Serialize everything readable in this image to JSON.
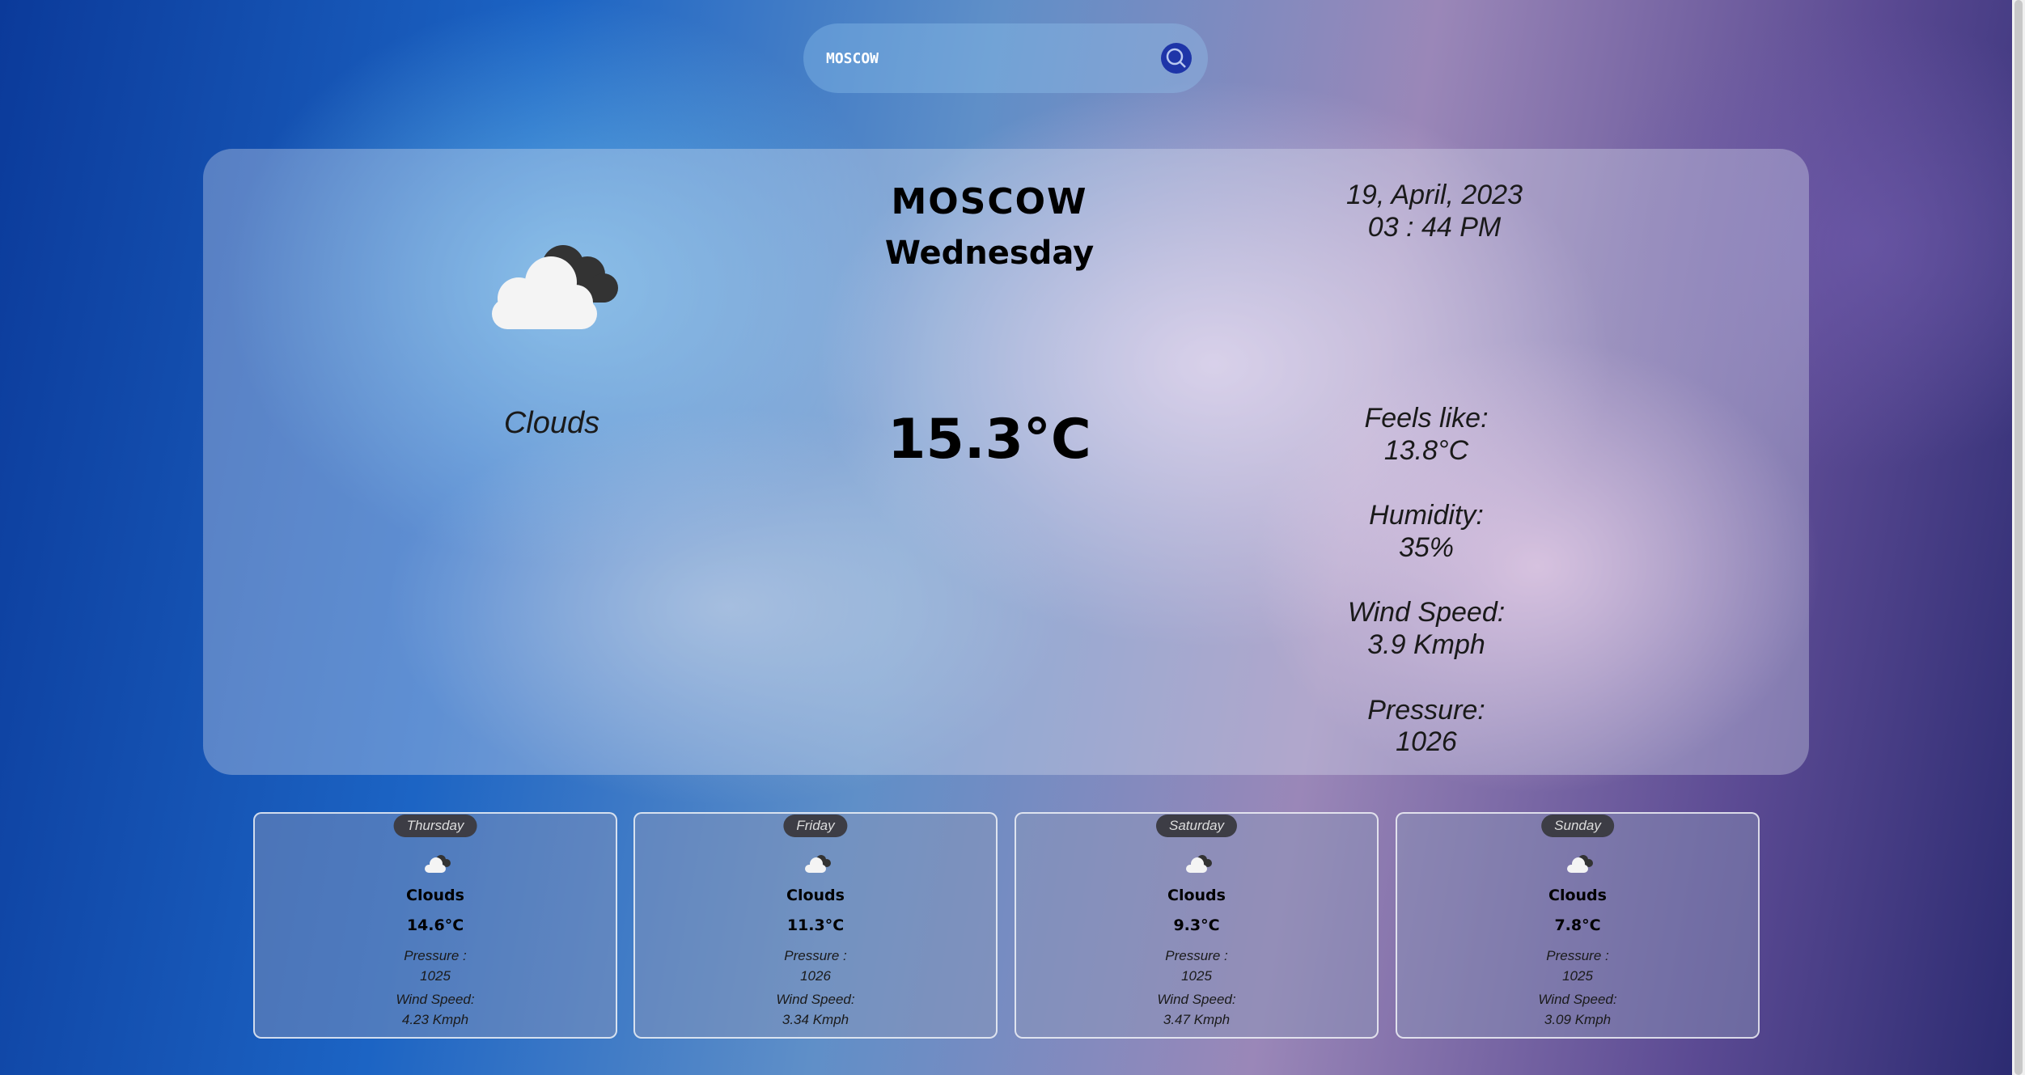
{
  "search": {
    "value": "MOSCOW",
    "button": "Search"
  },
  "current": {
    "city": "MOSCOW",
    "day": "Wednesday",
    "date": "19, April, 2023",
    "time": "03 : 44 PM",
    "condition": "Clouds",
    "temperature": "15.3°C",
    "feels_like_label": "Feels like:",
    "feels_like": "13.8°C",
    "humidity_label": "Humidity:",
    "humidity": "35%",
    "wind_label": "Wind Speed:",
    "wind": "3.9 Kmph",
    "pressure_label": "Pressure:",
    "pressure": "1026",
    "icon": "cloud-icon"
  },
  "forecast": [
    {
      "day": "Thursday",
      "condition": "Clouds",
      "temp": "14.6°C",
      "pressure_label": "Pressure :",
      "pressure": "1025",
      "wind_label": "Wind Speed:",
      "wind": "4.23 Kmph"
    },
    {
      "day": "Friday",
      "condition": "Clouds",
      "temp": "11.3°C",
      "pressure_label": "Pressure :",
      "pressure": "1026",
      "wind_label": "Wind Speed:",
      "wind": "3.34 Kmph"
    },
    {
      "day": "Saturday",
      "condition": "Clouds",
      "temp": "9.3°C",
      "pressure_label": "Pressure :",
      "pressure": "1025",
      "wind_label": "Wind Speed:",
      "wind": "3.47 Kmph"
    },
    {
      "day": "Sunday",
      "condition": "Clouds",
      "temp": "7.8°C",
      "pressure_label": "Pressure :",
      "pressure": "1025",
      "wind_label": "Wind Speed:",
      "wind": "3.09 Kmph"
    }
  ]
}
